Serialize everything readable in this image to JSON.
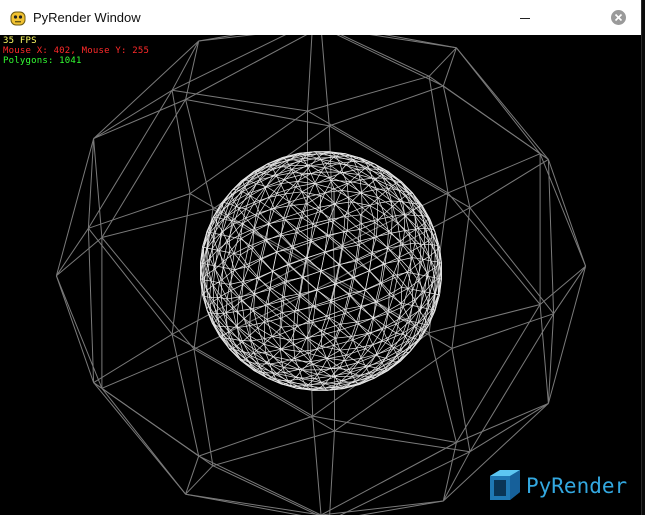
{
  "window": {
    "title": "PyRender Window",
    "icon": "pygame-snake-icon",
    "controls": {
      "minimize": "minimize-icon",
      "close": "close-icon"
    }
  },
  "hud": {
    "fps": "35 FPS",
    "mouse": "Mouse X: 402, Mouse Y: 255",
    "polygons": "Polygons: 1041",
    "colors": {
      "fps": "#ffff66",
      "mouse": "#ff2a2a",
      "polygons": "#33ff33"
    }
  },
  "scene": {
    "background": "#000000",
    "outer_mesh_color": "#7a7a7a",
    "inner_sphere_color": "#e6e6e6",
    "render_mode": "wireframe"
  },
  "logo": {
    "text": "PyRender",
    "icon": "cube-icon",
    "color": "#33a8e0"
  }
}
